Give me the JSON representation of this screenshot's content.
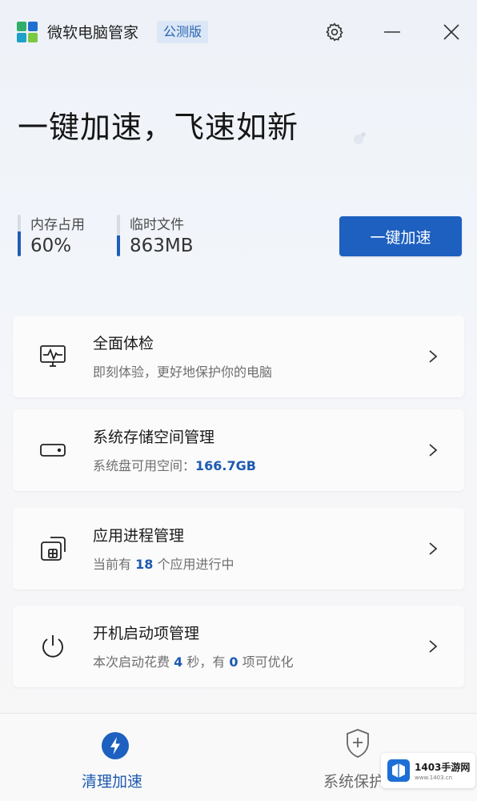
{
  "app": {
    "title": "微软电脑管家",
    "badge": "公测版",
    "brand_color": "#1d60c0"
  },
  "hero": {
    "title": "一键加速，飞速如新"
  },
  "stats": {
    "memory": {
      "label": "内存占用",
      "value": "60%",
      "fill": 0.6
    },
    "temp_files": {
      "label": "临时文件",
      "value": "863MB",
      "fill": 0.5
    }
  },
  "accelerate_button": {
    "label": "一键加速"
  },
  "cards": [
    {
      "icon": "monitor-heartbeat-icon",
      "title": "全面体检",
      "sub_prefix": "即刻体验，更好地保护你的电脑",
      "num": "",
      "sub_mid": "",
      "num2": "",
      "sub_suffix": ""
    },
    {
      "icon": "drive-icon",
      "title": "系统存储空间管理",
      "sub_prefix": "系统盘可用空间：",
      "num": "166.7GB",
      "sub_mid": "",
      "num2": "",
      "sub_suffix": ""
    },
    {
      "icon": "app-window-icon",
      "title": "应用进程管理",
      "sub_prefix": "当前有 ",
      "num": "18",
      "sub_mid": " 个应用进行中",
      "num2": "",
      "sub_suffix": ""
    },
    {
      "icon": "power-icon",
      "title": "开机启动项管理",
      "sub_prefix": "本次启动花费 ",
      "num": "4",
      "sub_mid": " 秒，有 ",
      "num2": "0",
      "sub_suffix": " 项可优化"
    }
  ],
  "bottom_nav": {
    "clean": {
      "label": "清理加速",
      "icon": "lightning-circle-icon",
      "active": true
    },
    "protect": {
      "label": "系统保护",
      "icon": "shield-plus-icon",
      "active": false
    }
  },
  "watermark": {
    "text": "1403手游网",
    "sub": "www.1403.cn"
  }
}
